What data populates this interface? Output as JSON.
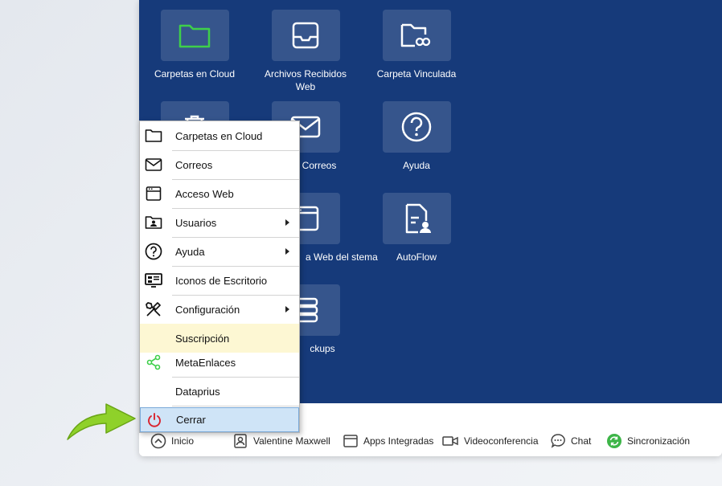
{
  "desktop": {
    "icons": [
      {
        "label": "Carpetas en Cloud",
        "icon": "folder-icon"
      },
      {
        "label": "Archivos Recibidos Web",
        "icon": "inbox-tray-icon"
      },
      {
        "label": "Carpeta Vinculada",
        "icon": "linked-folder-icon"
      },
      {
        "label": "Correos",
        "icon": "envelope-icon"
      },
      {
        "label": "Ayuda",
        "icon": "question-icon"
      },
      {
        "label": "a Web del stema",
        "icon": "browser-window-icon"
      },
      {
        "label": "AutoFlow",
        "icon": "document-user-icon"
      },
      {
        "label": "ckups",
        "icon": "database-icon"
      }
    ]
  },
  "menu": {
    "items": [
      {
        "label": "Carpetas en Cloud",
        "icon": "folder-icon"
      },
      {
        "label": "Correos",
        "icon": "envelope-icon"
      },
      {
        "label": "Acceso Web",
        "icon": "browser-window-icon"
      },
      {
        "label": "Usuarios",
        "icon": "user-card-icon",
        "submenu": true
      },
      {
        "label": "Ayuda",
        "icon": "question-icon",
        "submenu": true
      },
      {
        "label": "Iconos de Escritorio",
        "icon": "desktop-icons-icon"
      },
      {
        "label": "Configuración",
        "icon": "tools-icon",
        "submenu": true
      },
      {
        "label": "Suscripción",
        "icon": ""
      },
      {
        "label": "MetaEnlaces",
        "icon": "share-icon"
      },
      {
        "label": "Dataprius",
        "icon": ""
      },
      {
        "label": "Cerrar",
        "icon": "power-icon"
      }
    ]
  },
  "taskbar": {
    "start": "Inicio",
    "user": "Valentine Maxwell",
    "apps": "Apps Integradas",
    "video": "Videoconferencia",
    "chat": "Chat",
    "sync": "Sincronización"
  },
  "colors": {
    "desktop_bg": "#163a7a",
    "highlight_close": "#cfe4f7",
    "highlight_subscription": "#fdf7d3",
    "folder_green": "#3ecf4a",
    "power_red": "#d9232e",
    "arrow_green": "#8fd12a"
  }
}
